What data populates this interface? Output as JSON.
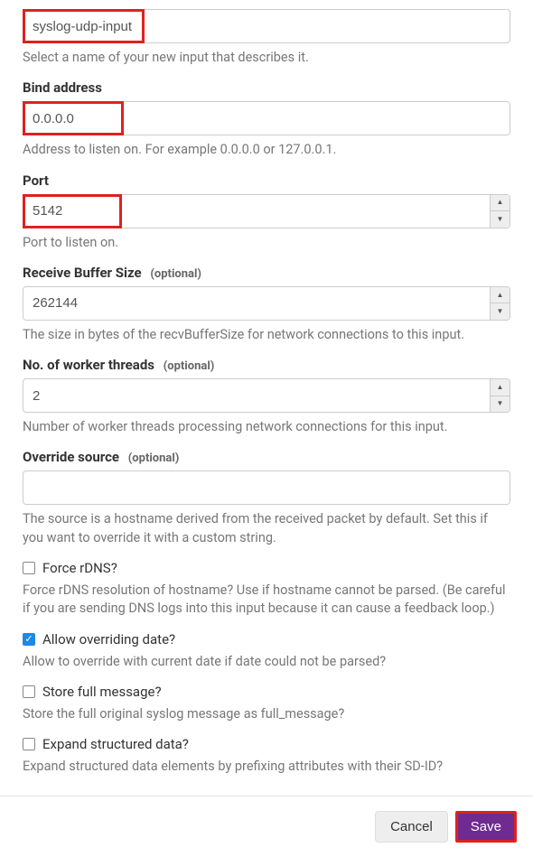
{
  "name": {
    "value": "syslog-udp-input",
    "help": "Select a name of your new input that describes it."
  },
  "bind": {
    "label": "Bind address",
    "value": "0.0.0.0",
    "help": "Address to listen on. For example 0.0.0.0 or 127.0.0.1."
  },
  "port": {
    "label": "Port",
    "value": "5142",
    "help": "Port to listen on."
  },
  "recvbuf": {
    "label": "Receive Buffer Size",
    "optional": "(optional)",
    "value": "262144",
    "help": "The size in bytes of the recvBufferSize for network connections to this input."
  },
  "workers": {
    "label": "No. of worker threads",
    "optional": "(optional)",
    "value": "2",
    "help": "Number of worker threads processing network connections for this input."
  },
  "override": {
    "label": "Override source",
    "optional": "(optional)",
    "value": "",
    "help": "The source is a hostname derived from the received packet by default. Set this if you want to override it with a custom string."
  },
  "rdns": {
    "label": "Force rDNS?",
    "help": "Force rDNS resolution of hostname? Use if hostname cannot be parsed. (Be careful if you are sending DNS logs into this input because it can cause a feedback loop.)"
  },
  "allowdate": {
    "label": "Allow overriding date?",
    "help": "Allow to override with current date if date could not be parsed?"
  },
  "storefull": {
    "label": "Store full message?",
    "help": "Store the full original syslog message as full_message?"
  },
  "expand": {
    "label": "Expand structured data?",
    "help": "Expand structured data elements by prefixing attributes with their SD-ID?"
  },
  "footer": {
    "cancel": "Cancel",
    "save": "Save"
  }
}
